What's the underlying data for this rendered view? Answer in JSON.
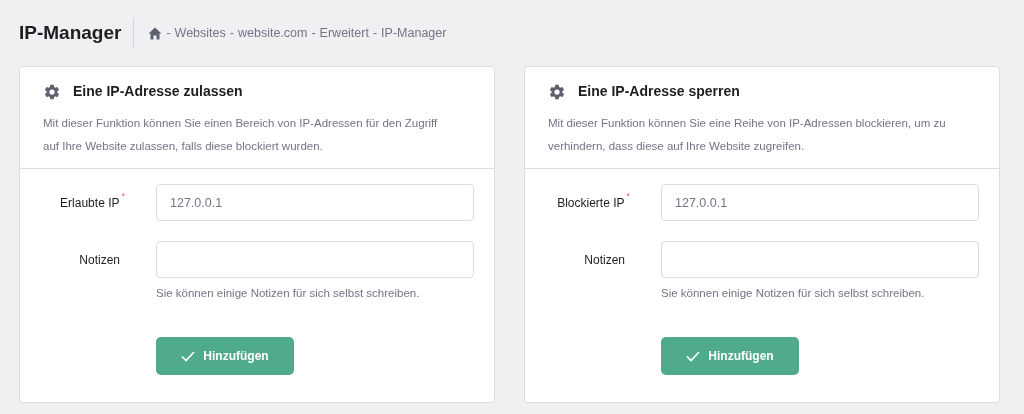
{
  "page_title": "IP-Manager",
  "breadcrumb": {
    "separator": "-",
    "items": [
      "Websites",
      "website.com",
      "Erweitert",
      "IP-Manager"
    ]
  },
  "cards": [
    {
      "title": "Eine IP-Adresse zulassen",
      "description": "Mit dieser Funktion können Sie einen Bereich von IP-Adressen für den Zugriff auf Ihre Website zulassen, falls diese blockiert wurden.",
      "fields": [
        {
          "label": "Erlaubte IP",
          "required_marker": "*",
          "value": "127.0.0.1"
        },
        {
          "label": "Notizen",
          "hint": "Sie können einige Notizen für sich selbst schreiben."
        }
      ],
      "button": "Hinzufügen"
    },
    {
      "title": "Eine IP-Adresse sperren",
      "description": "Mit dieser Funktion können Sie eine Reihe von IP-Adressen blockieren, um zu verhindern, dass diese auf Ihre Website zugreifen.",
      "fields": [
        {
          "label": "Blockierte IP",
          "required_marker": "*",
          "value": "127.0.0.1"
        },
        {
          "label": "Notizen",
          "hint": "Sie können einige Notizen für sich selbst schreiben."
        }
      ],
      "button": "Hinzufügen"
    }
  ]
}
